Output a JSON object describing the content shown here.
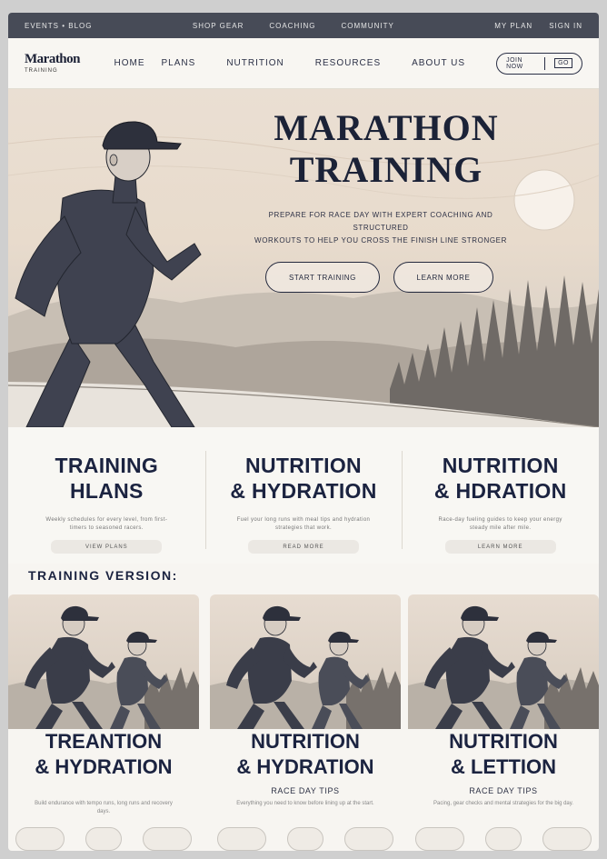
{
  "utility_bar": {
    "left_label": "EVENTS  •  BLOG",
    "links": [
      "SHOP GEAR",
      "COACHING",
      "COMMUNITY"
    ],
    "right_links": [
      "MY PLAN",
      "SIGN IN"
    ]
  },
  "nav": {
    "logo_main": "Marathon",
    "logo_sub": "TRAINING",
    "items": [
      "HOME",
      "PLANS",
      "NUTRITION",
      "RESOURCES",
      "ABOUT US"
    ],
    "cta_label": "JOIN NOW",
    "cta_box": "GO"
  },
  "hero": {
    "title_line1": "MARATHON",
    "title_line2": "TRAINING",
    "subtitle_line1": "PREPARE FOR RACE DAY WITH EXPERT COACHING AND STRUCTURED",
    "subtitle_line2": "WORKOUTS TO HELP YOU CROSS THE FINISH LINE STRONGER",
    "primary_button": "START TRAINING",
    "secondary_button": "LEARN MORE"
  },
  "features": [
    {
      "title_line1": "TRAINING",
      "title_line2": "HLANS",
      "desc": "Weekly schedules for every level, from first-timers to seasoned racers.",
      "link": "VIEW PLANS"
    },
    {
      "title_line1": "NUTRITION",
      "title_line2": "& HYDRATION",
      "desc": "Fuel your long runs with meal tips and hydration strategies that work.",
      "link": "READ MORE"
    },
    {
      "title_line1": "NUTRITION",
      "title_line2": "& HDRATION",
      "desc": "Race-day fueling guides to keep your energy steady mile after mile.",
      "link": "LEARN MORE"
    }
  ],
  "section_heading": "TRAINING VERSION:",
  "cards": [
    {
      "title_line1": "TREANTION",
      "title_line2": "& HYDRATION",
      "meta": "",
      "desc": "Build endurance with tempo runs, long runs and recovery days."
    },
    {
      "title_line1": "NUTRITION",
      "title_line2": "& HYDRATION",
      "meta": "RACE DAY TIPS",
      "desc": "Everything you need to know before lining up at the start."
    },
    {
      "title_line1": "NUTRITION",
      "title_line2": "& LETTION",
      "meta": "RACE DAY TIPS",
      "desc": "Pacing, gear checks and mental strategies for the big day."
    }
  ],
  "colors": {
    "navy": "#1b2340",
    "bar": "#474b57",
    "paper": "#f7f5f1",
    "hero_sky": "#eadfd3"
  }
}
